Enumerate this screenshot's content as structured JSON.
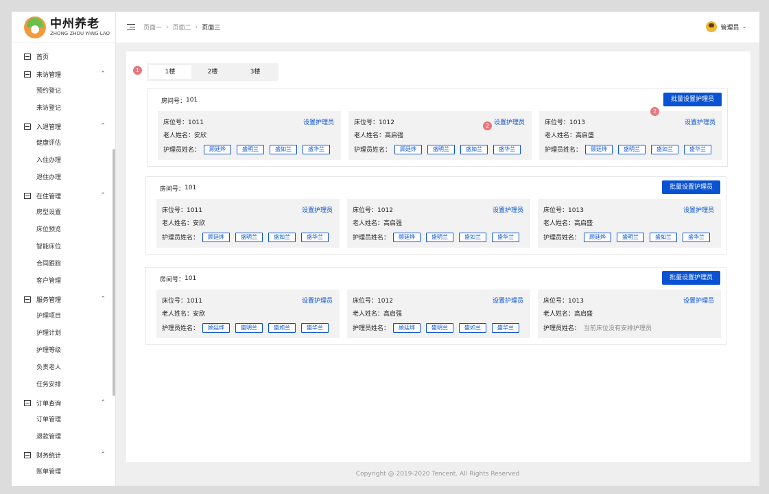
{
  "brand": {
    "name_cn": "中州养老",
    "name_en": "ZHONG ZHOU YANG LAO"
  },
  "sidebar": {
    "groups": [
      {
        "label": "首页",
        "expanded": false,
        "items": []
      },
      {
        "label": "来访管理",
        "expanded": true,
        "items": [
          "预约登记",
          "来访登记"
        ]
      },
      {
        "label": "入退管理",
        "expanded": true,
        "items": [
          "健康评估",
          "入住办理",
          "退住办理"
        ]
      },
      {
        "label": "在住管理",
        "expanded": true,
        "items": [
          "房型设置",
          "床位预览",
          "智能床位",
          "合同跟踪",
          "客户管理"
        ]
      },
      {
        "label": "服务管理",
        "expanded": true,
        "items": [
          "护理项目",
          "护理计划",
          "护理等级",
          "负责老人",
          "任务安排"
        ]
      },
      {
        "label": "订单查询",
        "expanded": true,
        "items": [
          "订单管理",
          "退款管理"
        ]
      },
      {
        "label": "财务统计",
        "expanded": true,
        "items": [
          "账单管理"
        ]
      }
    ]
  },
  "header": {
    "breadcrumb": [
      "页面一",
      "页面二",
      "页面三"
    ],
    "user": "管理员"
  },
  "tabs": [
    "1楼",
    "2楼",
    "3楼"
  ],
  "active_tab": 0,
  "labels": {
    "room_prefix": "房间号：",
    "bed_prefix": "床位号：",
    "elder_prefix": "老人姓名：",
    "nurse_prefix": "护理员姓名：",
    "batch_button": "批量设置护理员",
    "set_link": "设置护理员"
  },
  "rooms": [
    {
      "number": "101",
      "beds": [
        {
          "bed": "1011",
          "elder": "安欣",
          "nurses": [
            "顾廷烨",
            "盛明兰",
            "盛如兰",
            "盛华兰"
          ],
          "empty_text": ""
        },
        {
          "bed": "1012",
          "elder": "高启强",
          "nurses": [
            "顾廷烨",
            "盛明兰",
            "盛如兰",
            "盛华兰"
          ],
          "empty_text": ""
        },
        {
          "bed": "1013",
          "elder": "高启盛",
          "nurses": [
            "顾廷烨",
            "盛明兰",
            "盛如兰",
            "盛华兰"
          ],
          "empty_text": ""
        }
      ]
    },
    {
      "number": "101",
      "beds": [
        {
          "bed": "1011",
          "elder": "安欣",
          "nurses": [
            "顾廷烨",
            "盛明兰",
            "盛如兰",
            "盛华兰"
          ],
          "empty_text": ""
        },
        {
          "bed": "1012",
          "elder": "高启强",
          "nurses": [
            "顾廷烨",
            "盛明兰",
            "盛如兰",
            "盛华兰"
          ],
          "empty_text": ""
        },
        {
          "bed": "1013",
          "elder": "高启盛",
          "nurses": [
            "顾廷烨",
            "盛明兰",
            "盛如兰",
            "盛华兰"
          ],
          "empty_text": ""
        }
      ]
    },
    {
      "number": "101",
      "beds": [
        {
          "bed": "1011",
          "elder": "安欣",
          "nurses": [
            "顾廷烨",
            "盛明兰",
            "盛如兰",
            "盛华兰"
          ],
          "empty_text": ""
        },
        {
          "bed": "1012",
          "elder": "高启强",
          "nurses": [
            "顾廷烨",
            "盛明兰",
            "盛如兰",
            "盛华兰"
          ],
          "empty_text": ""
        },
        {
          "bed": "1013",
          "elder": "高启盛",
          "nurses": [],
          "empty_text": "当前床位没有安排护理员"
        }
      ]
    }
  ],
  "badges": [
    "1",
    "2",
    "2"
  ],
  "footer": "Copyright @ 2019-2020 Tencent. All Rights Reserved",
  "colors": {
    "primary": "#0a52d4",
    "badge": "#e8787d",
    "bed_bg": "#f2f2f2",
    "page_bg": "#efefef"
  }
}
